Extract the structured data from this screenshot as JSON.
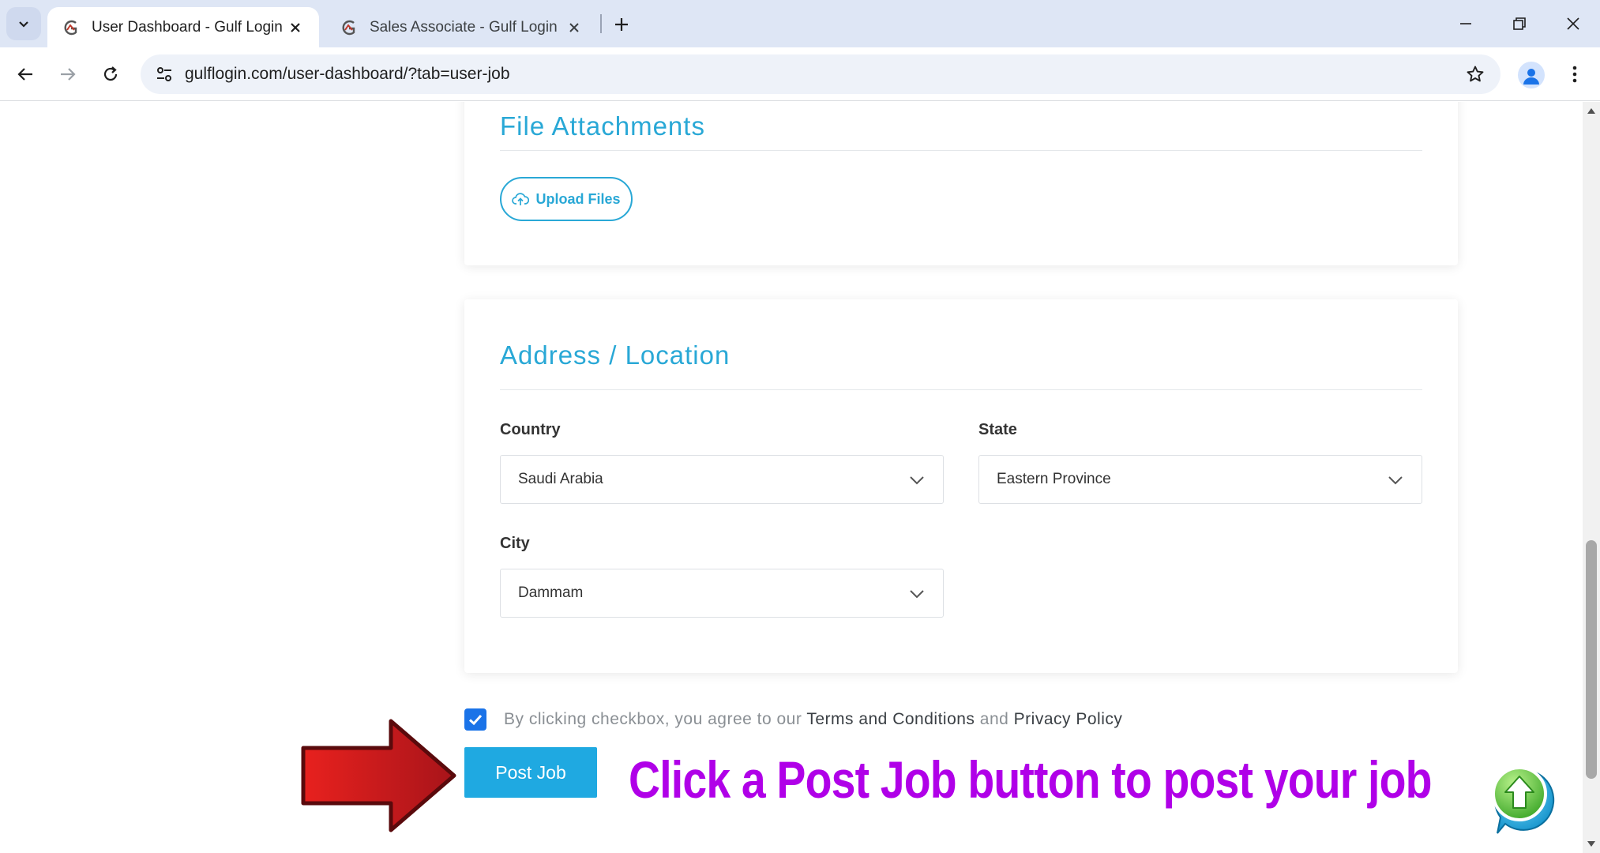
{
  "browser": {
    "tabs": [
      {
        "title": "User Dashboard - Gulf Login",
        "active": true
      },
      {
        "title": "Sales Associate - Gulf Login",
        "active": false
      }
    ],
    "url": "gulflogin.com/user-dashboard/?tab=user-job"
  },
  "file_attachments": {
    "heading": "File Attachments",
    "upload_label": "Upload Files"
  },
  "address": {
    "heading": "Address / Location",
    "country_label": "Country",
    "country_value": "Saudi Arabia",
    "state_label": "State",
    "state_value": "Eastern Province",
    "city_label": "City",
    "city_value": "Dammam"
  },
  "agreement": {
    "checked": true,
    "prefix": "By clicking checkbox, you agree to our",
    "terms": "Terms and Conditions",
    "conjunction": "and",
    "privacy": "Privacy Policy"
  },
  "post_button_label": "Post Job",
  "annotation_text": "Click a Post Job button to post your job",
  "colors": {
    "accent": "#29a8d6",
    "button": "#1fa9e1",
    "annotation": "#b000e8",
    "arrow": "#c4161c",
    "checkbox": "#1a73e8"
  }
}
